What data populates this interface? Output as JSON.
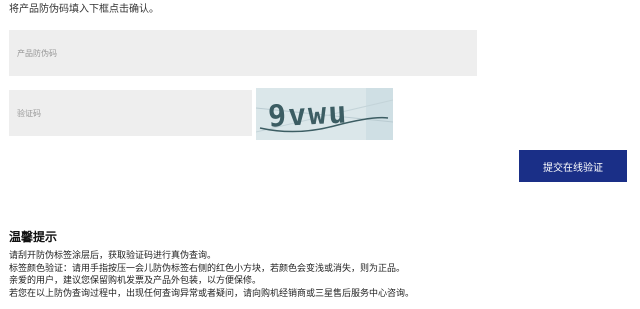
{
  "instruction": "将产品防伪码填入下框点击确认。",
  "fields": {
    "product_code_placeholder": "产品防伪码",
    "verify_code_placeholder": "验证码"
  },
  "captcha": {
    "text": "9vwu"
  },
  "submit": {
    "label": "提交在线验证",
    "color": "#1a2f87"
  },
  "tips": {
    "title": "温馨提示",
    "lines": [
      "请刮开防伪标签涂层后，获取验证码进行真伪查询。",
      "标签颜色验证：请用手指按压一会儿防伪标签右侧的红色小方块，若颜色会变浅或消失，则为正品。",
      "亲爱的用户，建议您保留购机发票及产品外包装，以方便保修。",
      "若您在以上防伪查询过程中，出现任何查询异常或者疑问，请向购机经销商或三星售后服务中心咨询。"
    ]
  }
}
